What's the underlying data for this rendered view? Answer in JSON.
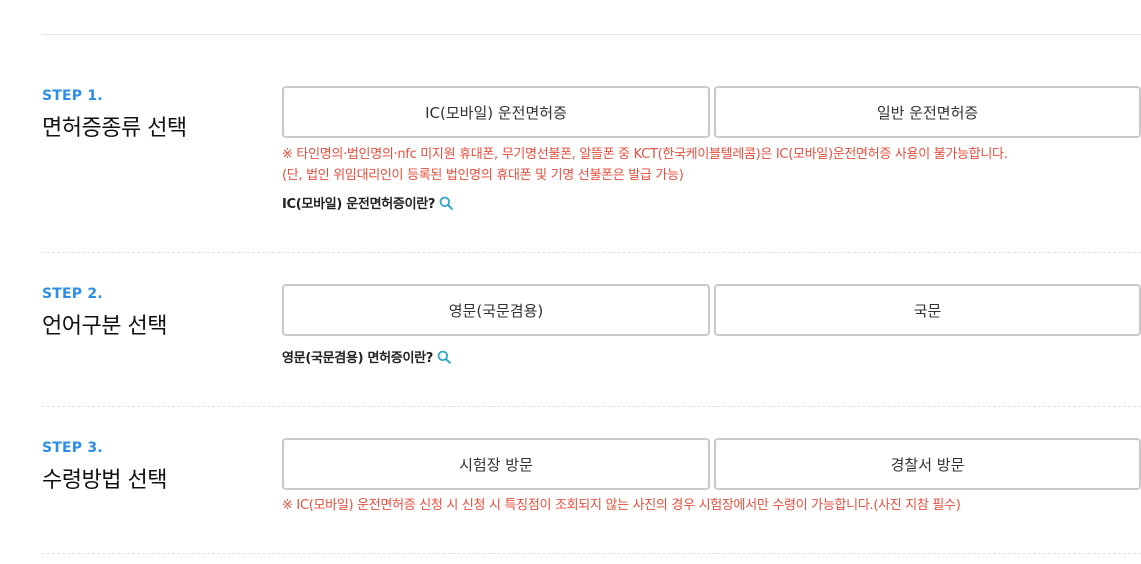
{
  "colors": {
    "step_accent": "#2e8ee6",
    "notice": "#e4503f",
    "magnifier": "#2fa6c4",
    "button_border": "#c9c9c9"
  },
  "steps": [
    {
      "label": "STEP 1.",
      "title": "면허증종류 선택",
      "options": [
        "IC(모바일) 운전면허증",
        "일반 운전면허증"
      ],
      "notices": [
        "※ 타인명의·법인명의·nfc 미지원 휴대폰, 무기명선불폰, 알뜰폰 중 KCT(한국케이블텔레콤)은 IC(모바일)운전면허증 사용이 불가능합니다.",
        "(단, 법인 위임대리인이 등록된 법인명의 휴대폰 및 기명 선불폰은 발급 가능)"
      ],
      "info_link": "IC(모바일) 운전면허증이란?",
      "info_icon": "search-icon"
    },
    {
      "label": "STEP 2.",
      "title": "언어구분 선택",
      "options": [
        "영문(국문겸용)",
        "국문"
      ],
      "info_link": "영문(국문겸용) 면허증이란?",
      "info_icon": "search-icon"
    },
    {
      "label": "STEP 3.",
      "title": "수령방법 선택",
      "options": [
        "시험장 방문",
        "경찰서 방문"
      ],
      "notices": [
        "※ IC(모바일) 운전면허증 신청 시 신청 시 특징점이 조회되지 않는 사진의 경우 시험장에서만 수령이 가능합니다.(사진 지참 필수)"
      ]
    }
  ]
}
